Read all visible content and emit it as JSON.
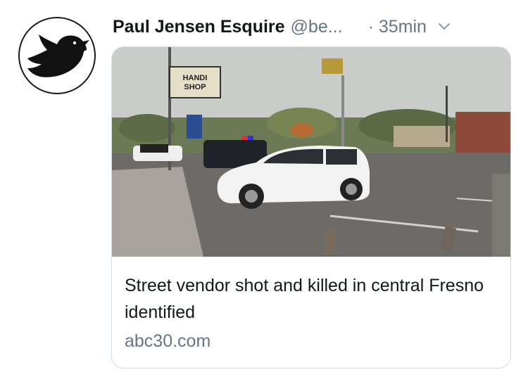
{
  "tweet": {
    "display_name": "Paul Jensen Esquire",
    "handle": "@be...",
    "time": "· 35min",
    "avatar_icon": "bird-silhouette-icon",
    "more_icon": "chevron-down-icon"
  },
  "card": {
    "image_sign_text": "HANDI SHOP",
    "title": "Street vendor shot and killed in central Fresno identified",
    "domain": "abc30.com"
  },
  "colors": {
    "text_primary": "#14171a",
    "text_secondary": "#657786",
    "border": "#d8dde2"
  }
}
